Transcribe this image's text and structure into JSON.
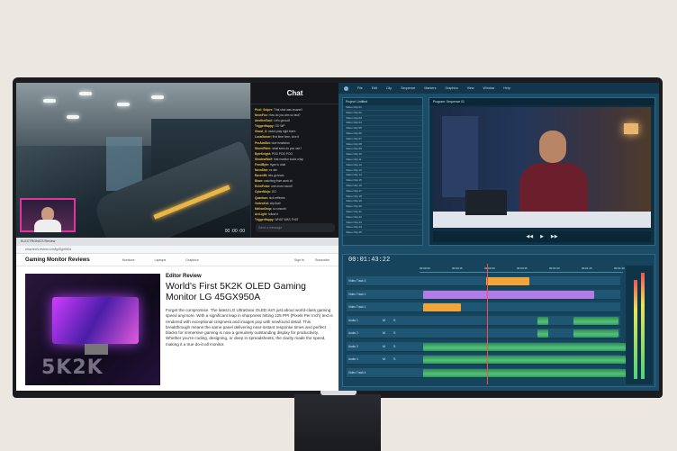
{
  "chat": {
    "title": "Chat",
    "messages": [
      {
        "user": "Pixel_Sniper:",
        "text": "That shot was insane!!"
      },
      {
        "user": "NeonFox:",
        "text": "How do you aim so fast?"
      },
      {
        "user": "AnotherSoul:",
        "text": "Let's goooo!!"
      },
      {
        "user": "TriggerHappy:",
        "text": "GG WP"
      },
      {
        "user": "Ghost_X:",
        "text": "clutch play right there"
      },
      {
        "user": "LunaGamer:",
        "text": "first time here, love it"
      },
      {
        "user": "ProAimBot:",
        "text": "nice headshot"
      },
      {
        "user": "StormRider:",
        "text": "what sens do you use?"
      },
      {
        "user": "ByteKnight:",
        "text": "POG POG POG"
      },
      {
        "user": "ShadowWolf:",
        "text": "that monitor looks crisp"
      },
      {
        "user": "FrostByte:",
        "text": "hype in chat"
      },
      {
        "user": "NovaStar:",
        "text": "ez win"
      },
      {
        "user": "Raven99:",
        "text": "lets go team"
      },
      {
        "user": "Blaze:",
        "text": "watching from work lol"
      },
      {
        "user": "EchoPulse:",
        "text": "one more round!"
      },
      {
        "user": "CyberNinja:",
        "text": "GG"
      },
      {
        "user": "Quantum:",
        "text": "sick reflexes"
      },
      {
        "user": "VortexKid:",
        "text": "clip that!"
      },
      {
        "user": "MellowDrop:",
        "text": "so smooth"
      },
      {
        "user": "ArcLight:",
        "text": "follow'd"
      },
      {
        "user": "TriggerHappy:",
        "text": "WHAT WAS THAT"
      }
    ],
    "input_placeholder": "Send a message"
  },
  "game": {
    "hud_text": "00 :00 :00"
  },
  "browser": {
    "tab_label": "ELECTRONICS Review",
    "url": "www.tech-review.com/lg45gx950a",
    "site_name": "Gaming Monitor Reviews",
    "nav": [
      "Monitors",
      "Laptops",
      "Graphics"
    ],
    "nav_right": [
      "Sign In",
      "Subscribe"
    ],
    "image_text": "5K2K",
    "kicker": "Editor Review",
    "headline": "World's First 5K2K OLED Gaming Monitor LG 45GX950A",
    "body": "Forget the compromise. The latest LG UltraGear OLED isn't just about world-class gaming speed anymore. With a significant leap in sharpness hitting 125 PPI (Pixels Per Inch) text is rendered with exceptional crispness and images pop with newfound detail. This breakthrough means the same panel delivering near-instant response times and perfect blacks for immersive gaming is now a genuinely outstanding display for productivity. Whether you're coding, designing, or deep in spreadsheets, the clarity made the speed, making it a true do-it-all monitor."
  },
  "editor": {
    "menu": [
      "File",
      "Edit",
      "Clip",
      "Sequence",
      "Markers",
      "Graphics",
      "View",
      "Window",
      "Help"
    ],
    "bin_title": "Project: Untitled",
    "bin_rows": [
      "Video Clip 01",
      "Video Clip 02",
      "Video Clip 03",
      "Video Clip 04",
      "Video Clip 05",
      "Video Clip 06",
      "Video Clip 07",
      "Video Clip 08",
      "Video Clip 09",
      "Video Clip 10",
      "Video Clip 11",
      "Video Clip 12",
      "Video Clip 13",
      "Video Clip 14",
      "Video Clip 15",
      "Video Clip 16",
      "Video Clip 17",
      "Video Clip 18",
      "Video Clip 19",
      "Video Clip 20",
      "Video Clip 21",
      "Video Clip 22",
      "Video Clip 23",
      "Video Clip 24",
      "Video Clip 25"
    ],
    "viewer_tab": "Program: Sequence 01",
    "source_timecode": "00:01:43:22",
    "timeline_timecode": "00:01:43:22",
    "ruler": [
      "00:00:00",
      "00:00:15",
      "00:00:30",
      "00:00:45",
      "00:01:00",
      "00:01:15",
      "00:01:30"
    ],
    "tracks": [
      {
        "name": "Video Track 3",
        "buttons": ""
      },
      {
        "name": "Video Track 2",
        "buttons": ""
      },
      {
        "name": "Video Track 1",
        "buttons": ""
      },
      {
        "name": "Audio 1",
        "buttons": "M S"
      },
      {
        "name": "Audio 2",
        "buttons": "M S"
      },
      {
        "name": "Audio 3",
        "buttons": "M S"
      },
      {
        "name": "Audio 4",
        "buttons": "M S"
      },
      {
        "name": "Video Track 4",
        "buttons": ""
      }
    ],
    "colors": {
      "video_clip": "#f0a43a",
      "title_clip": "#b27be6",
      "audio_clip": "#3aa864"
    }
  }
}
